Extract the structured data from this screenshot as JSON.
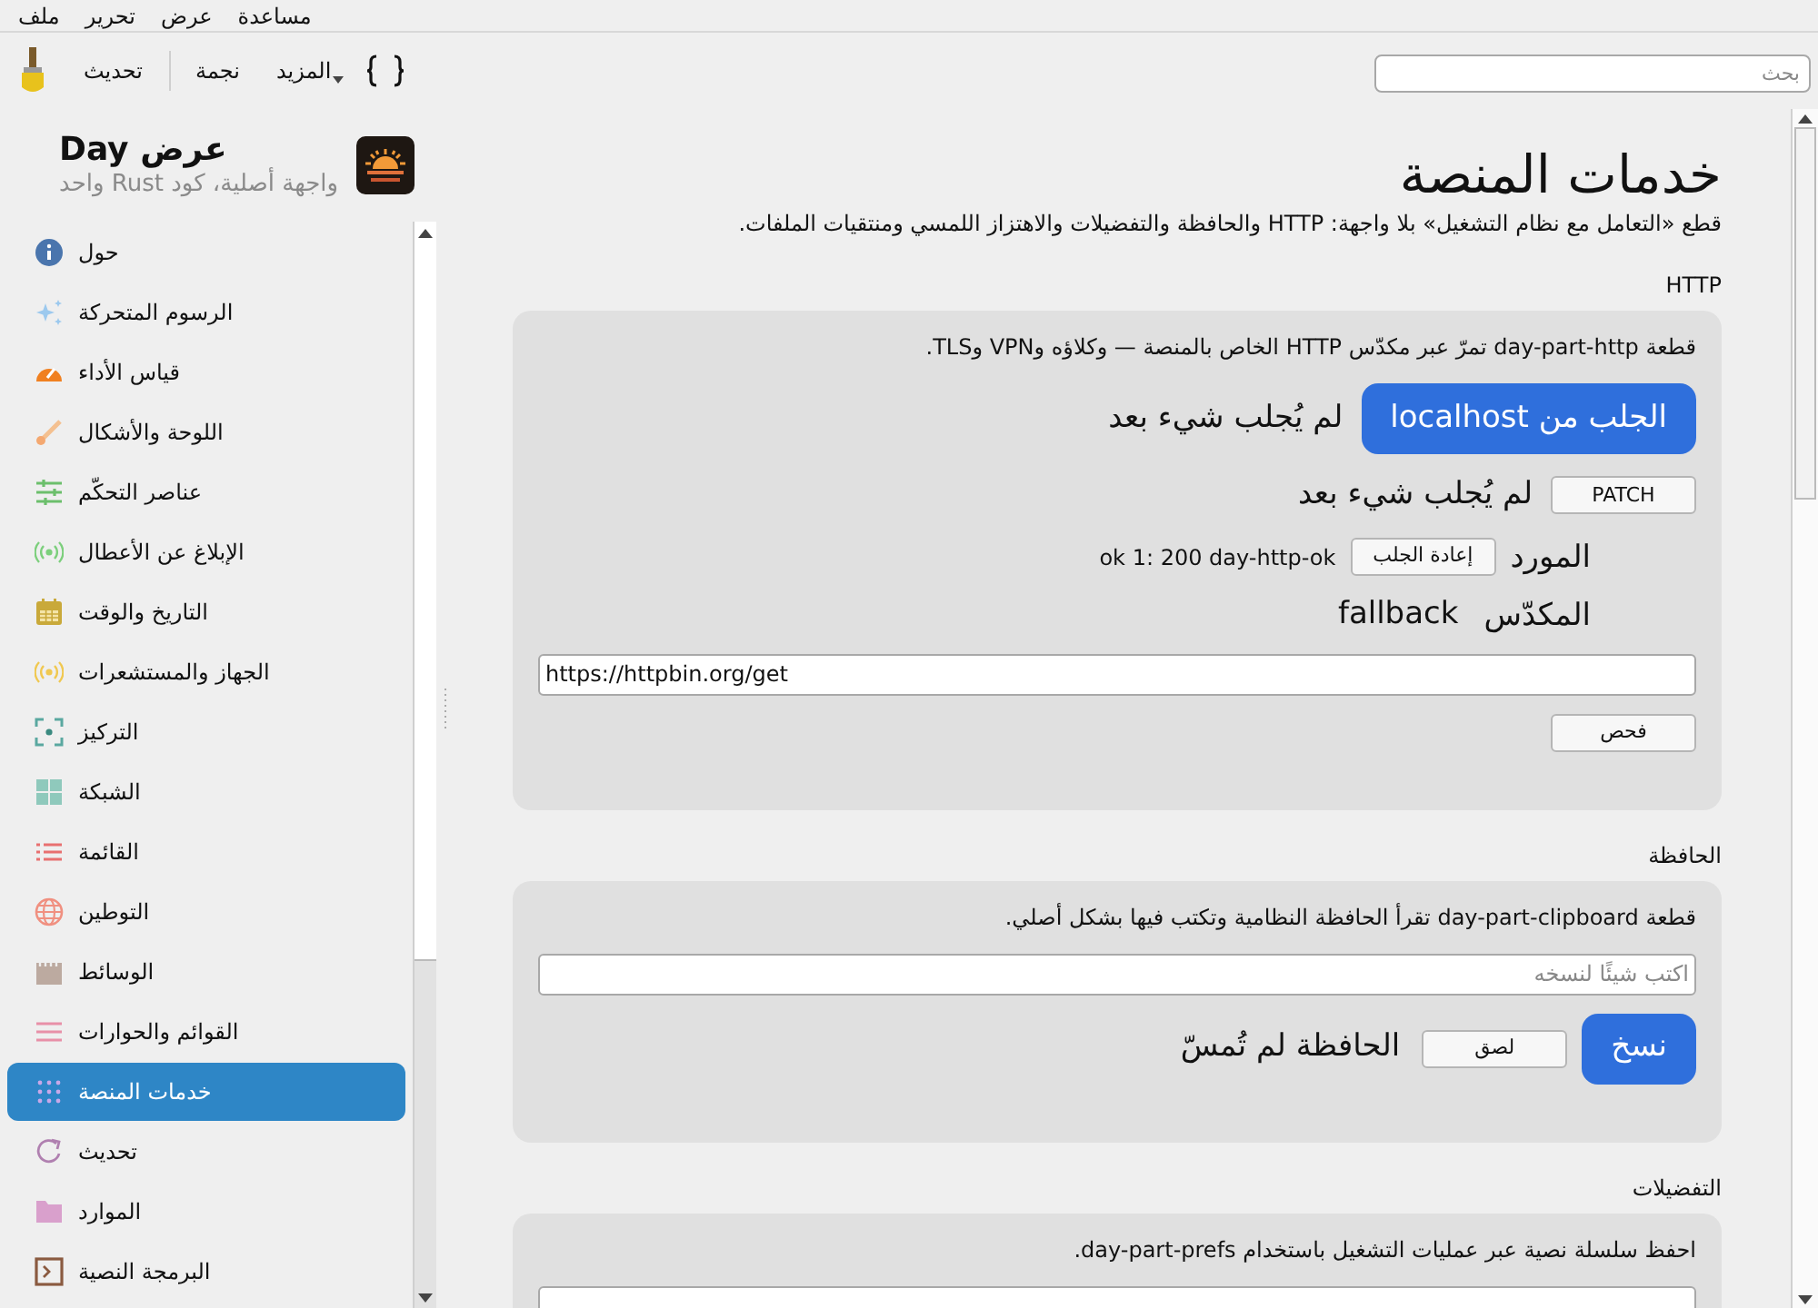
{
  "menu": [
    {
      "label": "مساعدة"
    },
    {
      "label": "عرض"
    },
    {
      "label": "تحرير"
    },
    {
      "label": "ملف"
    }
  ],
  "toolbar": {
    "items": [
      {
        "label": "المزيد"
      },
      {
        "label": "نجمة"
      },
      {
        "label": "تحديث"
      }
    ],
    "search": {
      "placeholder": "بحث"
    }
  },
  "sidebar": {
    "app_title": "عرض Day",
    "app_subtitle": "واجهة أصلية، كود Rust واحد",
    "items": [
      {
        "label": "حول",
        "selected": false
      },
      {
        "label": "الرسوم المتحركة",
        "selected": false
      },
      {
        "label": "قياس الأداء",
        "selected": false
      },
      {
        "label": "اللوحة والأشكال",
        "selected": false
      },
      {
        "label": "عناصر التحكّم",
        "selected": false
      },
      {
        "label": "الإبلاغ عن الأعطال",
        "selected": false
      },
      {
        "label": "التاريخ والوقت",
        "selected": false
      },
      {
        "label": "الجهاز والمستشعرات",
        "selected": false
      },
      {
        "label": "التركيز",
        "selected": false
      },
      {
        "label": "الشبكة",
        "selected": false
      },
      {
        "label": "القائمة",
        "selected": false
      },
      {
        "label": "التوطين",
        "selected": false
      },
      {
        "label": "الوسائط",
        "selected": false
      },
      {
        "label": "القوائم والحوارات",
        "selected": false
      },
      {
        "label": "خدمات المنصة",
        "selected": true
      },
      {
        "label": "تحديث",
        "selected": false
      },
      {
        "label": "الموارد",
        "selected": false
      },
      {
        "label": "البرمجة النصية",
        "selected": false
      }
    ]
  },
  "page": {
    "title": "خدمات المنصة",
    "description": "قطع «التعامل مع نظام التشغيل» بلا واجهة: HTTP والحافظة والتفضيلات والاهتزاز اللمسي ومنتقيات الملفات.",
    "sections": [
      {
        "heading": "HTTP",
        "description": "قطعة day-part-http تمرّ عبر مكدّس HTTP الخاص بالمنصة — وكلاؤه وVPN وTLS.",
        "rows": [
          {
            "kind": "action",
            "button": "الجلب من localhost",
            "primary": true,
            "status": "لم يُجلب شيء بعد"
          },
          {
            "kind": "action",
            "button": "PATCH",
            "primary": false,
            "status": "لم يُجلب شيء بعد"
          },
          {
            "kind": "labeled",
            "label": "المورد",
            "button": "إعادة الجلب",
            "value": "ok 1: 200 day-http-ok"
          },
          {
            "kind": "labeled",
            "label": "المكدّس",
            "value": "fallback"
          },
          {
            "kind": "input",
            "value": "https://httpbin.org/get"
          },
          {
            "kind": "button",
            "button": "فحص"
          }
        ]
      },
      {
        "heading": "الحافظة",
        "description": "قطعة day-part-clipboard تقرأ الحافظة النظامية وتكتب فيها بشكل أصلي.",
        "rows": [
          {
            "kind": "input",
            "placeholder": "اكتب شيئًا لنسخه"
          },
          {
            "kind": "clipboard",
            "primary_button": "نسخ",
            "button": "لصق",
            "status": "الحافظة لم تُمسّ"
          }
        ]
      },
      {
        "heading": "التفضيلات",
        "description": "احفظ سلسلة نصية عبر عمليات التشغيل باستخدام day-part-prefs.",
        "rows": [
          {
            "kind": "input"
          }
        ]
      }
    ]
  }
}
